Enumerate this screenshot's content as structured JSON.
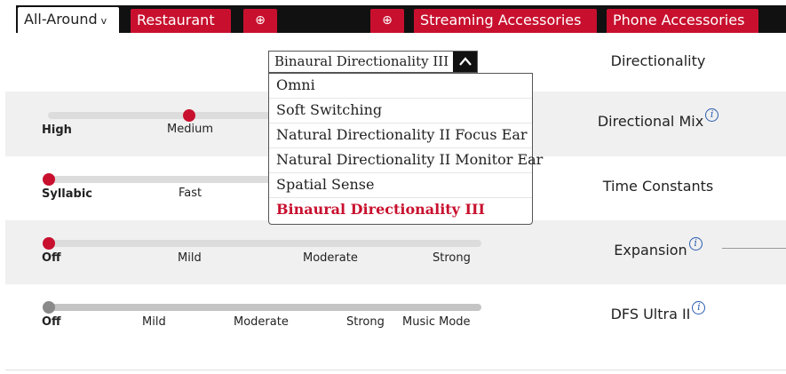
{
  "tabs": [
    {
      "label": "All-Around",
      "active": true,
      "has_chevron": true
    },
    {
      "label": "Restaurant",
      "active": false
    },
    {
      "label": "⊕",
      "kind": "add"
    },
    {
      "label": "⊕",
      "kind": "add"
    },
    {
      "label": "Streaming Accessories",
      "active": false
    },
    {
      "label": "Phone Accessories",
      "active": false
    }
  ],
  "directionality": {
    "label": "Directionality",
    "selected": "Binaural Directionality III",
    "options": [
      "Omni",
      "Soft Switching",
      "Natural Directionality II Focus Ear",
      "Natural Directionality II Monitor Ear",
      "Spatial Sense",
      "Binaural Directionality III"
    ]
  },
  "rows": {
    "directional_mix": {
      "label": "Directional Mix",
      "ticks": [
        "High",
        "Medium"
      ],
      "value": "Medium"
    },
    "time_constants": {
      "label": "Time Constants",
      "ticks": [
        "Syllabic",
        "Fast"
      ],
      "value": "Syllabic"
    },
    "expansion": {
      "label": "Expansion",
      "ticks": [
        "Off",
        "Mild",
        "Moderate",
        "Strong"
      ],
      "value": "Off"
    },
    "dfs": {
      "label": "DFS Ultra II",
      "ticks": [
        "Off",
        "Mild",
        "Moderate",
        "Strong",
        "Music Mode"
      ],
      "value": "Off"
    }
  },
  "icons": {
    "info": "i",
    "chevron": "v",
    "caret_up": "^"
  },
  "colors": {
    "accent": "#c8102e",
    "info": "#2a5db0",
    "tabbar": "#111111"
  }
}
